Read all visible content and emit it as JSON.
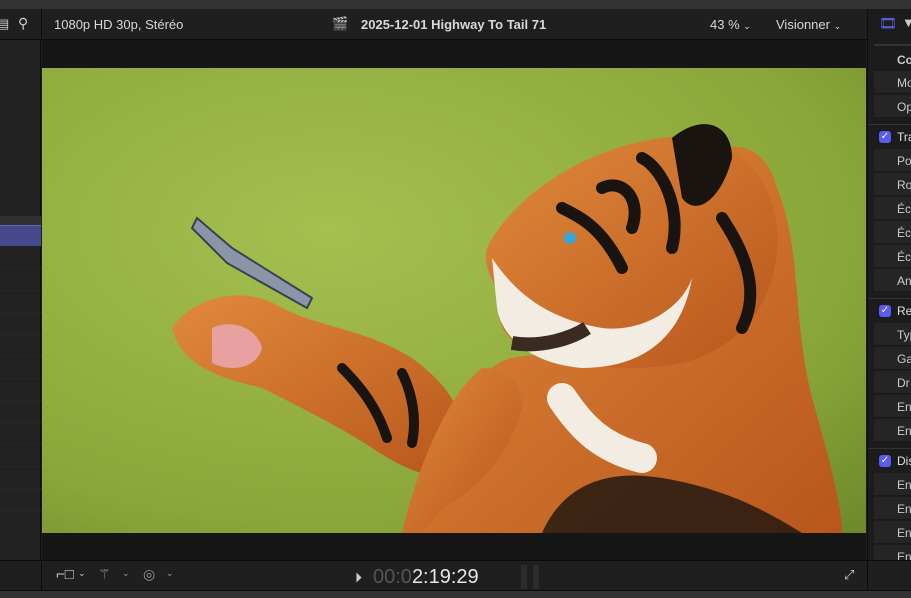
{
  "toolbar": {
    "format": "1080p HD 30p, Stéréo",
    "clip_title": "2025-12-01 Highway To Tail 71",
    "zoom": "43 %",
    "view_menu": "Visionner"
  },
  "inspector": {
    "top_rows": [
      "Co",
      "Mo",
      "Op"
    ],
    "sections": [
      {
        "label": "Tra",
        "checked": true,
        "rows": [
          "Po",
          "Ro",
          "Éc",
          "Éc",
          "Éc",
          "An"
        ]
      },
      {
        "label": "Re",
        "checked": true,
        "rows": [
          "Typ",
          "Ga",
          "Dr",
          "En",
          "En"
        ]
      },
      {
        "label": "Dis",
        "checked": true,
        "rows": [
          "En",
          "En",
          "En",
          "En"
        ]
      }
    ]
  },
  "timecode": {
    "dim": "00:0",
    "bright": "2:19:29"
  },
  "colors": {
    "accent": "#5b5bf0",
    "selection": "#46488c",
    "background": "#1f1f1f"
  }
}
